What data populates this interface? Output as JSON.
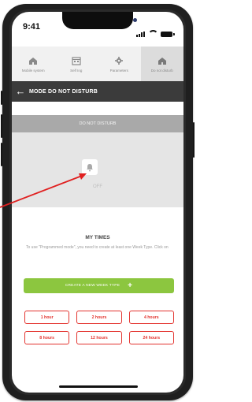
{
  "status_bar": {
    "time": "9:41"
  },
  "tabs": [
    {
      "label": "Mobile system",
      "icon": "house-icon"
    },
    {
      "label": "Self Ing",
      "icon": "calendar-icon"
    },
    {
      "label": "Parameters",
      "icon": "settings-icon"
    },
    {
      "label": "Do not disturb",
      "icon": "house-icon"
    }
  ],
  "header": {
    "title": "MODE DO NOT DISTURB"
  },
  "dnd": {
    "bar_label": "DO NOT DISTURB",
    "state_label": "OFF"
  },
  "my_times": {
    "title": "MY TIMES",
    "info": "To use \"Programmed mode\", you need to create at least one Week Type. Click on",
    "create_label": "CREATE A NEW WEEK TYPE",
    "durations": [
      "1 hour",
      "2 hours",
      "4 hours",
      "8 hours",
      "12 hours",
      "24 hours"
    ]
  },
  "colors": {
    "accent_green": "#8cc63f",
    "duration_red": "#e3342f",
    "header_dark": "#3b3b3b",
    "annotation_arrow": "#e02020"
  }
}
